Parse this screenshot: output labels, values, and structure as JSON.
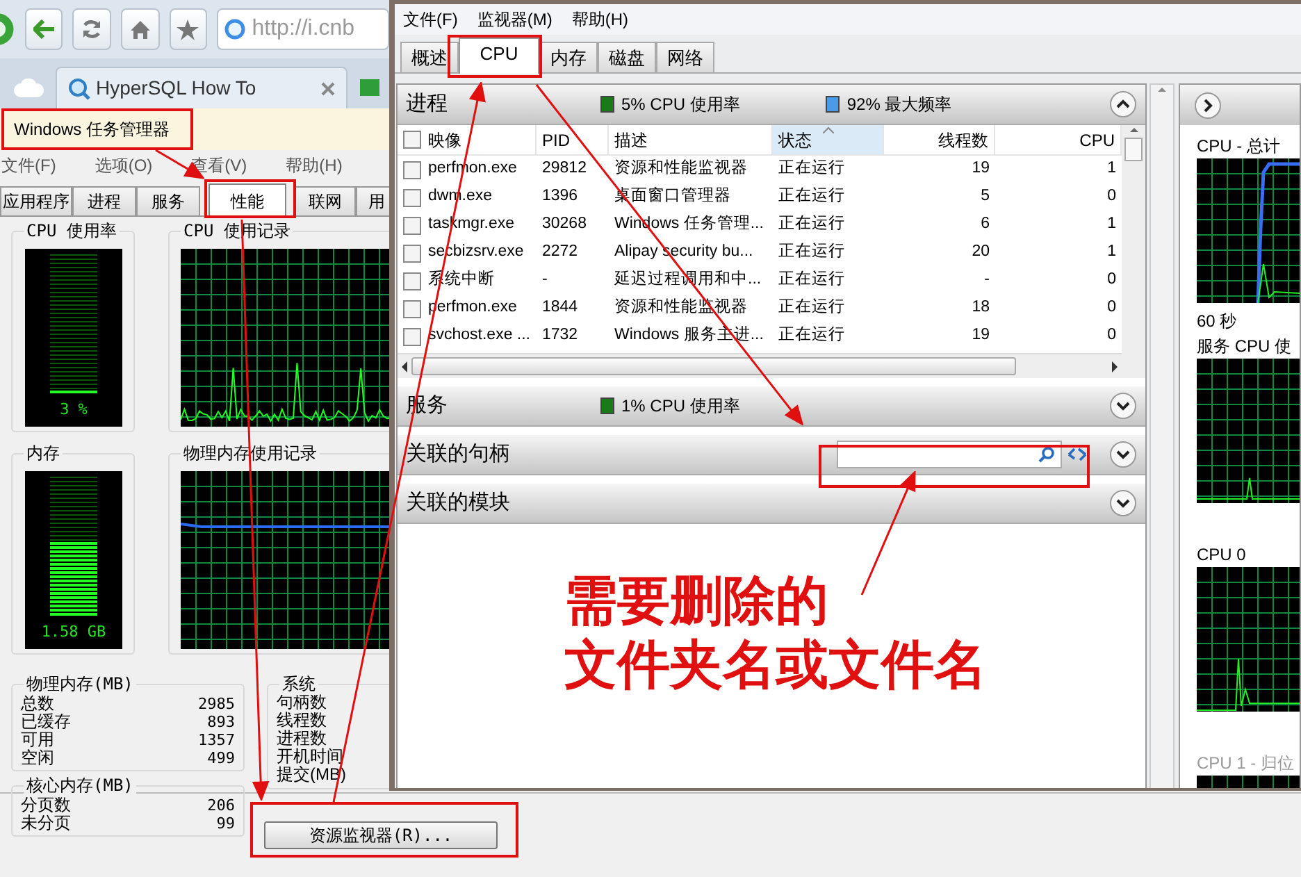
{
  "browser": {
    "address": "http://i.cnb",
    "tab_title": "HyperSQL How To"
  },
  "task_manager": {
    "title": "Windows 任务管理器",
    "menu": [
      "文件(F)",
      "选项(O)",
      "查看(V)",
      "帮助(H)"
    ],
    "tabs": [
      {
        "label": "应用程序",
        "selected": false
      },
      {
        "label": "进程",
        "selected": false
      },
      {
        "label": "服务",
        "selected": false
      },
      {
        "label": "性能",
        "selected": true
      },
      {
        "label": "联网",
        "selected": false
      },
      {
        "label": "用",
        "selected": false
      }
    ],
    "cpu_meter": {
      "title": "CPU 使用率",
      "reading": "3 %",
      "level": 0.03
    },
    "cpu_history": {
      "title": "CPU 使用记录"
    },
    "memory_meter": {
      "title": "内存",
      "reading": "1.58 GB",
      "level": 0.53
    },
    "memory_history": {
      "title": "物理内存使用记录"
    },
    "physical_memory": {
      "title": "物理内存(MB)",
      "rows": [
        {
          "label": "总数",
          "value": "2985"
        },
        {
          "label": "已缓存",
          "value": "893"
        },
        {
          "label": "可用",
          "value": "1357"
        },
        {
          "label": "空闲",
          "value": "499"
        }
      ]
    },
    "kernel_memory": {
      "title": "核心内存(MB)",
      "rows": [
        {
          "label": "分页数",
          "value": "206"
        },
        {
          "label": "未分页",
          "value": "99"
        }
      ]
    },
    "system": {
      "title": "系统",
      "rows": [
        "句柄数",
        "线程数",
        "进程数",
        "开机时间",
        "提交(MB)"
      ]
    },
    "button": "资源监视器(R)..."
  },
  "resource_monitor": {
    "menu": [
      "文件(F)",
      "监视器(M)",
      "帮助(H)"
    ],
    "tabs": [
      {
        "label": "概述",
        "selected": false
      },
      {
        "label": "CPU",
        "selected": true
      },
      {
        "label": "内存",
        "selected": false
      },
      {
        "label": "磁盘",
        "selected": false
      },
      {
        "label": "网络",
        "selected": false
      }
    ],
    "processes": {
      "title": "进程",
      "cpu_legend": "5% CPU 使用率",
      "frequency_legend": "92% 最大频率",
      "expanded": true,
      "columns": [
        {
          "label": "映像",
          "sorted": false
        },
        {
          "label": "PID",
          "sorted": false
        },
        {
          "label": "描述",
          "sorted": false
        },
        {
          "label": "状态",
          "sorted": true
        },
        {
          "label": "线程数",
          "sorted": false
        },
        {
          "label": "CPU",
          "sorted": false
        }
      ],
      "rows": [
        {
          "checked": false,
          "cells": [
            "perfmon.exe",
            "29812",
            "资源和性能监视器",
            "正在运行",
            "19",
            "1"
          ]
        },
        {
          "checked": false,
          "cells": [
            "dwm.exe",
            "1396",
            "桌面窗口管理器",
            "正在运行",
            "5",
            "0"
          ]
        },
        {
          "checked": false,
          "cells": [
            "taskmgr.exe",
            "30268",
            "Windows 任务管理...",
            "正在运行",
            "6",
            "1"
          ]
        },
        {
          "checked": false,
          "cells": [
            "secbizsrv.exe",
            "2272",
            "Alipay security bu...",
            "正在运行",
            "20",
            "1"
          ]
        },
        {
          "checked": false,
          "cells": [
            "系统中断",
            "-",
            "延迟过程调用和中...",
            "正在运行",
            "-",
            "0"
          ]
        },
        {
          "checked": false,
          "cells": [
            "perfmon.exe",
            "1844",
            "资源和性能监视器",
            "正在运行",
            "18",
            "0"
          ]
        },
        {
          "checked": false,
          "cells": [
            "svchost.exe ...",
            "1732",
            "Windows 服务主进...",
            "正在运行",
            "19",
            "0"
          ]
        }
      ]
    },
    "sections": [
      {
        "kind": "legend",
        "title": "服务",
        "legend": "1% CPU 使用率",
        "expanded": false
      },
      {
        "kind": "search",
        "title": "关联的句柄",
        "expanded": false
      },
      {
        "kind": "plain",
        "title": "关联的模块",
        "expanded": false
      }
    ],
    "graphs": [
      {
        "title": "CPU - 总计",
        "caption": "60 秒",
        "disabled": false
      },
      {
        "title": "服务 CPU 使",
        "disabled": false
      },
      {
        "title": "CPU 0",
        "disabled": false
      },
      {
        "title": "CPU 1 - 归位",
        "disabled": true
      }
    ]
  },
  "callout": {
    "lines": [
      "需要删除的",
      "文件夹名或文件名"
    ]
  }
}
